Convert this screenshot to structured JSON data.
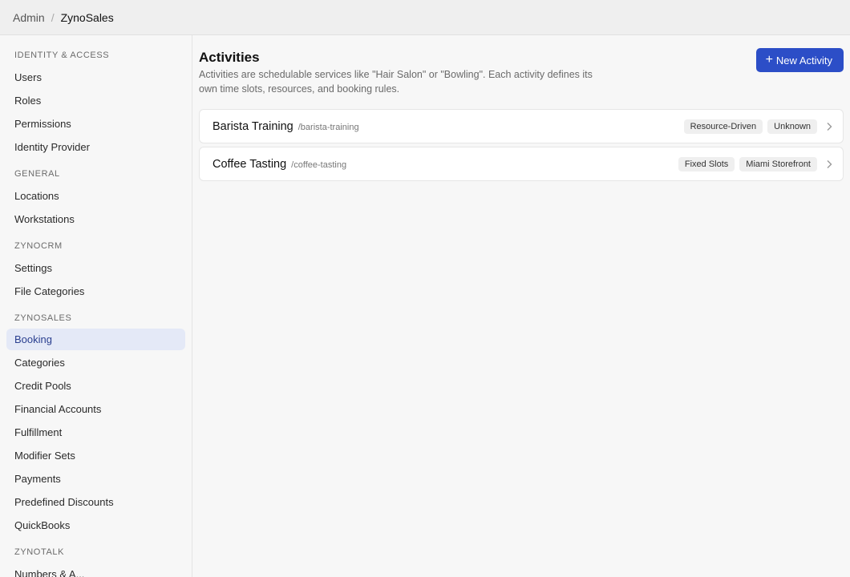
{
  "breadcrumb": {
    "root": "Admin",
    "separator": "/",
    "current": "ZynoSales"
  },
  "sidebar": {
    "sections": [
      {
        "title": "IDENTITY & ACCESS",
        "items": [
          "Users",
          "Roles",
          "Permissions",
          "Identity Provider"
        ]
      },
      {
        "title": "GENERAL",
        "items": [
          "Locations",
          "Workstations"
        ]
      },
      {
        "title": "ZYNOCRM",
        "items": [
          "Settings",
          "File Categories"
        ]
      },
      {
        "title": "ZYNOSALES",
        "items": [
          "Booking",
          "Categories",
          "Credit Pools",
          "Financial Accounts",
          "Fulfillment",
          "Modifier Sets",
          "Payments",
          "Predefined Discounts",
          "QuickBooks"
        ]
      },
      {
        "title": "ZYNOTALK",
        "items": [
          "Numbers & A..."
        ]
      }
    ],
    "active_item": "Booking"
  },
  "main": {
    "title": "Activities",
    "description": "Activities are schedulable services like \"Hair Salon\" or \"Bowling\". Each activity defines its own time slots, resources, and booking rules.",
    "new_button_label": "New Activity",
    "activities": [
      {
        "name": "Barista Training",
        "slug": "/barista-training",
        "tags": [
          "Resource-Driven",
          "Unknown"
        ]
      },
      {
        "name": "Coffee Tasting",
        "slug": "/coffee-tasting",
        "tags": [
          "Fixed Slots",
          "Miami Storefront"
        ]
      }
    ]
  },
  "colors": {
    "accent": "#2c4ec7",
    "active_bg": "#e4e9f7",
    "active_text": "#2a3f8f"
  },
  "icons": {
    "new_button": "plus-icon",
    "row_action": "chevron-right-icon"
  }
}
